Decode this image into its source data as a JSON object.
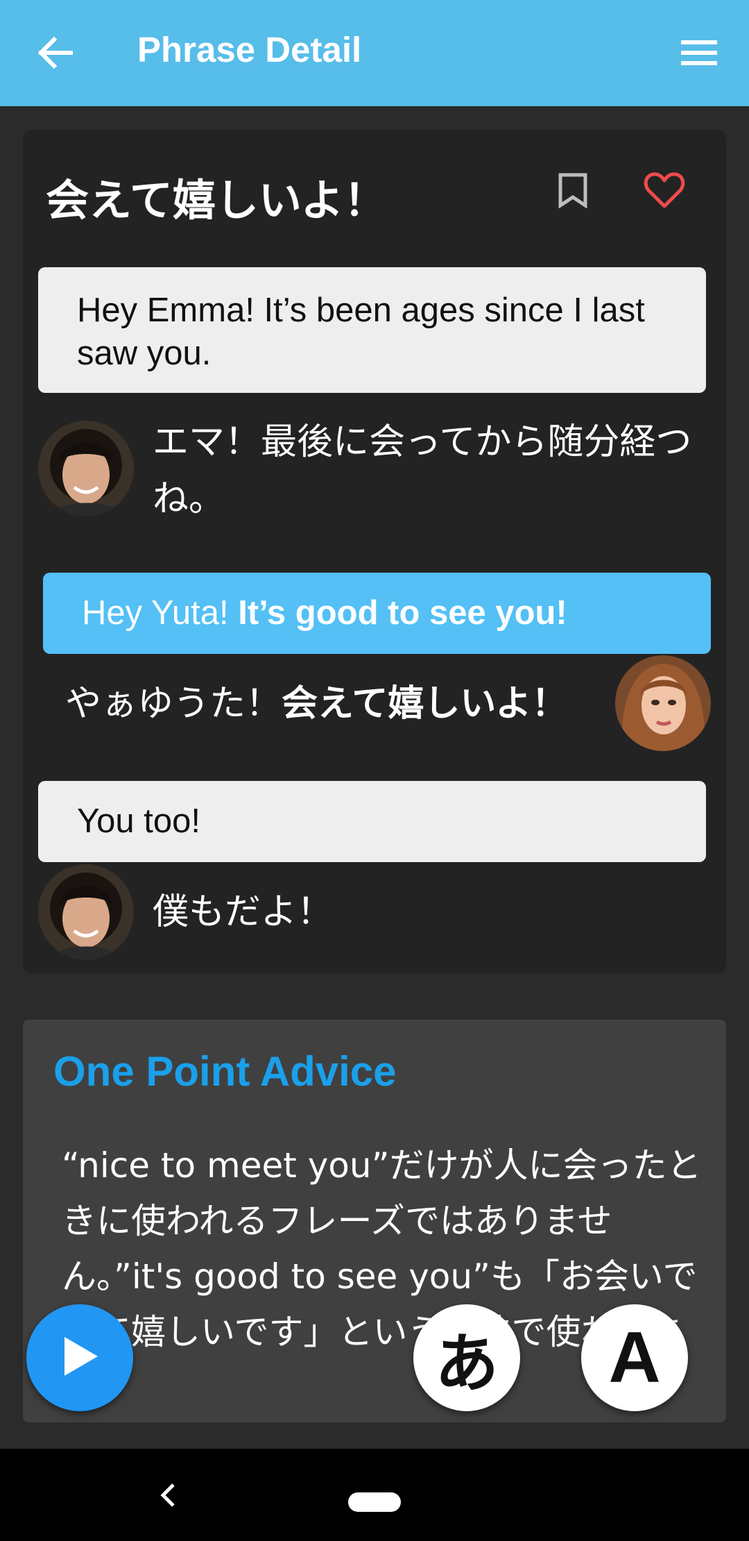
{
  "appbar": {
    "title": "Phrase Detail",
    "back_icon": "arrow-back-icon",
    "menu_icon": "hamburger-menu-icon",
    "color": "#57bde9"
  },
  "phrase": {
    "title": "会えて嬉しいよ！",
    "bookmark_icon": "bookmark-icon",
    "favorite_icon": "heart-icon",
    "favorite_color": "#f04b4b"
  },
  "dialogue": [
    {
      "speaker": "Yuta",
      "english": "Hey Emma! It’s been ages since I last saw you.",
      "japanese": "エマ！最後に会ってから随分経つね。"
    },
    {
      "speaker": "Emma",
      "english_plain": "Hey Yuta! ",
      "english_bold": "It’s good to see you!",
      "japanese_plain": "やぁゆうた！",
      "japanese_bold": "会えて嬉しいよ！"
    },
    {
      "speaker": "Yuta",
      "english": "You too!",
      "japanese": "僕もだよ！"
    }
  ],
  "advice": {
    "title": "One Point Advice",
    "body": "“nice to meet you”だけが人に会ったときに使われるフレーズではありません。”it's good to see you”も「お会いできて嬉しいです」という意味で使われます。",
    "title_color": "#1aa0ea"
  },
  "fabs": {
    "play_icon": "play-icon",
    "kana_label": "あ",
    "alpha_label": "A"
  },
  "system_nav": {
    "back_icon": "nav-back-icon",
    "home_icon": "home-pill-icon"
  }
}
